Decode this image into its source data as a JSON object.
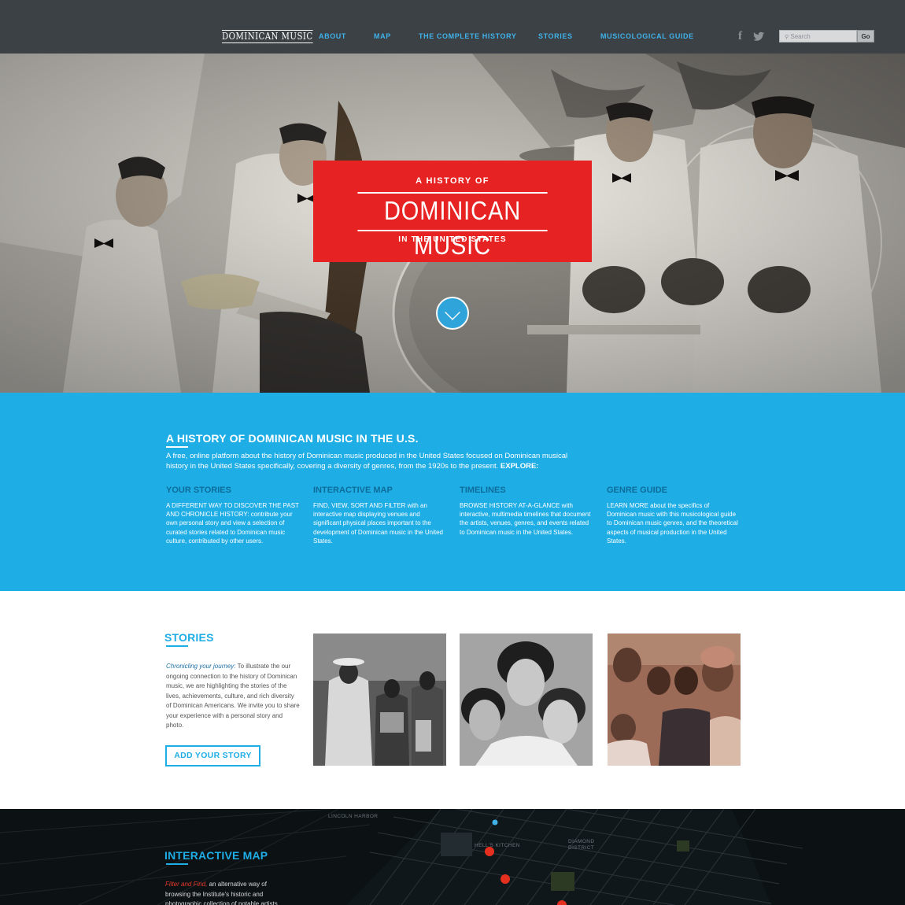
{
  "nav": {
    "logo": "DOMINICAN MUSIC",
    "items": [
      "ABOUT",
      "MAP",
      "THE COMPLETE HISTORY",
      "STORIES",
      "MUSICOLOGICAL GUIDE"
    ],
    "social": {
      "facebook": "f",
      "twitter": "t"
    },
    "search_placeholder": "Search",
    "go_label": "Go"
  },
  "hero": {
    "title_top": "A HISTORY OF",
    "title_main": "DOMINICAN MUSIC",
    "title_bottom": "IN THE UNITED STATES",
    "card_color": "#e62222",
    "scroll_icon": "chevron-down-icon"
  },
  "intro": {
    "title": "A HISTORY OF DOMINICAN MUSIC IN THE U.S.",
    "text": "A free, online platform about the history of Dominican music produced in the United States focused on Dominican musical history in the United States specifically, covering a diversity of genres, from the 1920s to the present.",
    "text_bold": "EXPLORE:",
    "columns": [
      {
        "title": "YOUR STORIES",
        "text": "A DIFFERENT WAY TO DISCOVER THE PAST AND CHRONICLE HISTORY: contribute your own personal story and view a selection of curated stories related to Dominican music culture, contributed by other users."
      },
      {
        "title": "INTERACTIVE MAP",
        "text": "FIND, VIEW, SORT AND FILTER with an interactive map displaying venues and significant physical places important to the development of Dominican music in the United States."
      },
      {
        "title": "TIMELINES",
        "text": "BROWSE HISTORY AT-A-GLANCE with interactive, multimedia timelines that document the artists, venues, genres, and events related to Dominican music in the United States."
      },
      {
        "title": "GENRE GUIDE",
        "text": "LEARN MORE about the specifics of Dominican music with this musicological guide to Dominican music genres, and the theoretical aspects of musical production in the United States."
      }
    ],
    "background": "#1fade6"
  },
  "stories": {
    "title": "STORIES",
    "lead_italic": "Chronicling your journey:",
    "text": "To illustrate the our ongoing connection to the  history of Dominican music, we are highlighting the stories of the lives, achievements, culture, and rich diversity of Dominican Americans. We invite you to share your experience with a personal story and photo.",
    "button": "ADD YOUR STORY"
  },
  "map": {
    "title": "INTERACTIVE MAP",
    "lead_italic": "Filter and Find,",
    "text": "an alternative way of browsing the Institute's historic and photographic collection of notable artists",
    "labels": [
      "LINCOLN HARBOR",
      "HELL'S KITCHEN",
      "DIAMOND DISTRICT"
    ]
  }
}
